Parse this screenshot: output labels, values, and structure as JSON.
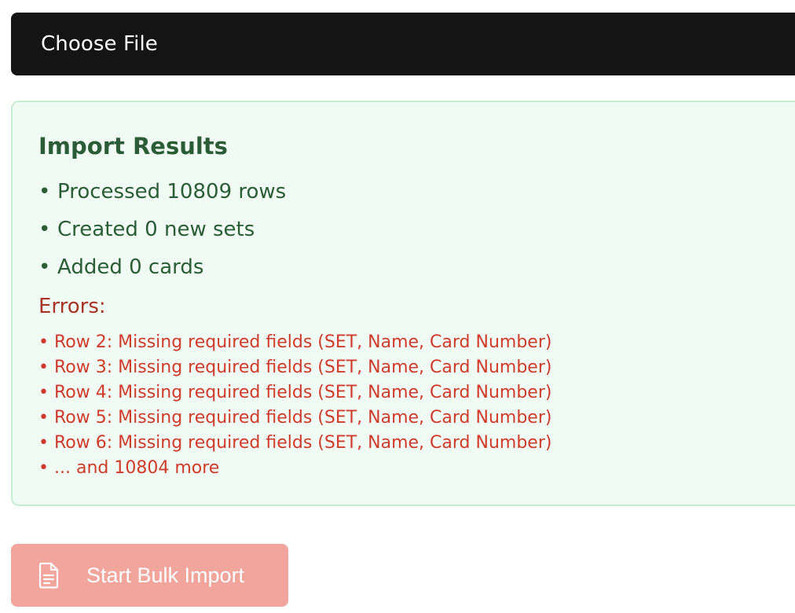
{
  "file_input": {
    "label": "Choose File"
  },
  "results": {
    "title": "Import Results",
    "summary": [
      "Processed 10809 rows",
      "Created 0 new sets",
      "Added 0 cards"
    ],
    "errors_heading": "Errors:",
    "errors": [
      "Row 2: Missing required fields (SET, Name, Card Number)",
      "Row 3: Missing required fields (SET, Name, Card Number)",
      "Row 4: Missing required fields (SET, Name, Card Number)",
      "Row 5: Missing required fields (SET, Name, Card Number)",
      "Row 6: Missing required fields (SET, Name, Card Number)",
      "... and 10804 more"
    ]
  },
  "actions": {
    "start_label": "Start Bulk Import",
    "start_icon": "document-icon"
  },
  "colors": {
    "file_bar": "#141414",
    "panel_bg": "#f0fbf3",
    "panel_border": "#c8ecd2",
    "success_text": "#2b5c37",
    "error_heading": "#a83427",
    "error_text": "#d03a2c",
    "button_disabled": "#f1a59c"
  }
}
